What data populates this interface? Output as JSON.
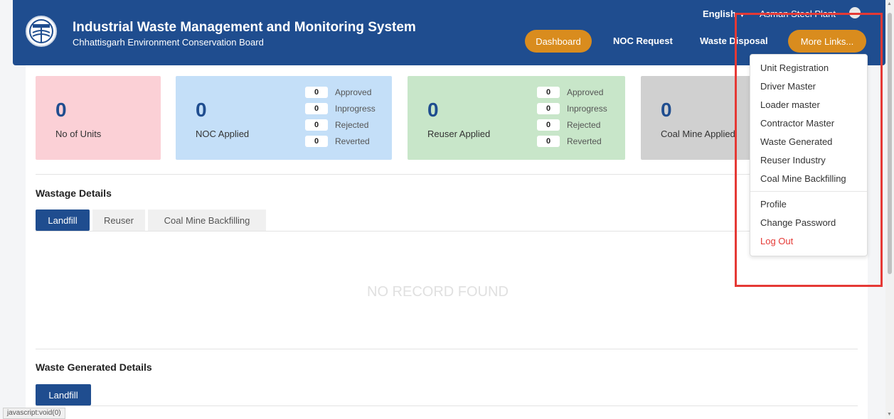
{
  "header": {
    "title": "Industrial Waste Management and Monitoring System",
    "subtitle": "Chhattisgarh Environment Conservation Board",
    "language": "English",
    "user": "Asman Steel Plant",
    "nav": {
      "dashboard": "Dashboard",
      "noc_request": "NOC Request",
      "waste_disposal": "Waste Disposal",
      "more_links": "More Links..."
    }
  },
  "cards": {
    "units": {
      "value": "0",
      "label": "No of Units",
      "color": "#fbd0d6"
    },
    "noc": {
      "value": "0",
      "label": "NOC Applied",
      "color": "#c4dff8",
      "statuses": [
        {
          "count": "0",
          "label": "Approved"
        },
        {
          "count": "0",
          "label": "Inprogress"
        },
        {
          "count": "0",
          "label": "Rejected"
        },
        {
          "count": "0",
          "label": "Reverted"
        }
      ]
    },
    "reuser": {
      "value": "0",
      "label": "Reuser Applied",
      "color": "#c8e6c9",
      "statuses": [
        {
          "count": "0",
          "label": "Approved"
        },
        {
          "count": "0",
          "label": "Inprogress"
        },
        {
          "count": "0",
          "label": "Rejected"
        },
        {
          "count": "0",
          "label": "Reverted"
        }
      ]
    },
    "coal": {
      "value": "0",
      "label": "Coal Mine Applied",
      "color": "#d0d0d0"
    }
  },
  "wastage": {
    "title": "Wastage Details",
    "tabs": [
      "Landfill",
      "Reuser",
      "Coal Mine Backfilling"
    ],
    "empty_text": "NO RECORD FOUND"
  },
  "generated": {
    "title": "Waste Generated Details",
    "tab": "Landfill"
  },
  "dropdown": {
    "items": [
      "Unit Registration",
      "Driver Master",
      "Loader master",
      "Contractor Master",
      "Waste Generated",
      "Reuser Industry",
      "Coal Mine Backfilling"
    ],
    "account": [
      "Profile",
      "Change Password"
    ],
    "logout": "Log Out"
  },
  "statusbar": "javascript:void(0)",
  "colors": {
    "primary": "#1f4d8f",
    "accent": "#d98c1e",
    "danger": "#e53935"
  }
}
